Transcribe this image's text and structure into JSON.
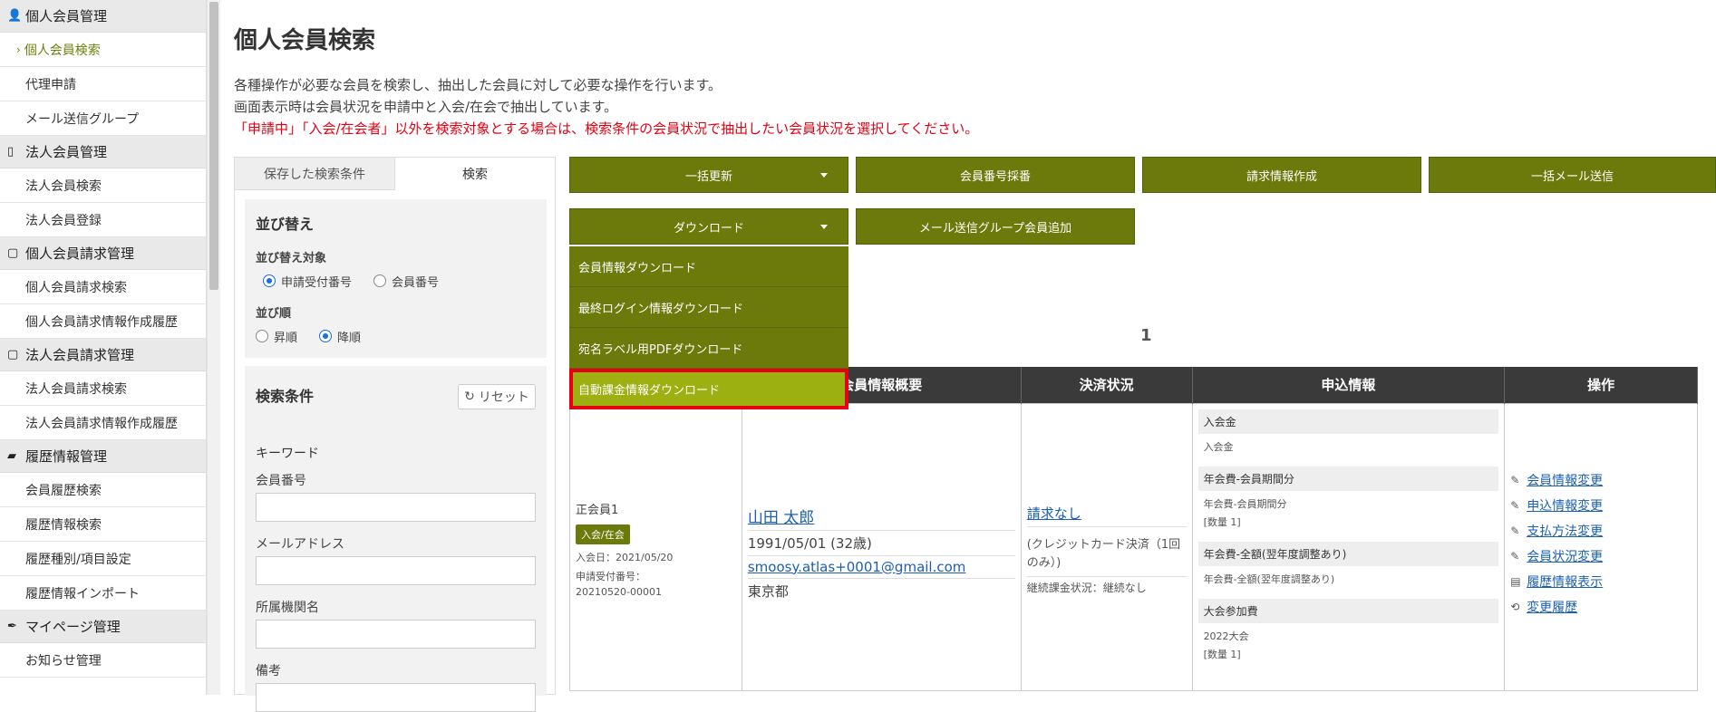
{
  "sidebar": {
    "sections": [
      {
        "icon": "person-icon",
        "glyph": "👤",
        "title": "個人会員管理",
        "items": [
          {
            "label": "個人会員検索",
            "active": true
          },
          {
            "label": "代理申請"
          },
          {
            "label": "メール送信グループ"
          }
        ]
      },
      {
        "icon": "building-icon",
        "glyph": "▯",
        "title": "法人会員管理",
        "items": [
          {
            "label": "法人会員検索"
          },
          {
            "label": "法人会員登録"
          }
        ]
      },
      {
        "icon": "document-icon",
        "glyph": "▢",
        "title": "個人会員請求管理",
        "items": [
          {
            "label": "個人会員請求検索"
          },
          {
            "label": "個人会員請求情報作成履歴"
          }
        ]
      },
      {
        "icon": "document-icon",
        "glyph": "▢",
        "title": "法人会員請求管理",
        "items": [
          {
            "label": "法人会員請求検索"
          },
          {
            "label": "法人会員請求情報作成履歴"
          }
        ]
      },
      {
        "icon": "folder-icon",
        "glyph": "▰",
        "title": "履歴情報管理",
        "items": [
          {
            "label": "会員履歴検索"
          },
          {
            "label": "履歴情報検索"
          },
          {
            "label": "履歴種別/項目設定"
          },
          {
            "label": "履歴情報インポート"
          }
        ]
      },
      {
        "icon": "pen-icon",
        "glyph": "✒",
        "title": "マイページ管理",
        "items": [
          {
            "label": "お知らせ管理"
          }
        ]
      }
    ]
  },
  "page": {
    "title": "個人会員検索",
    "desc1": "各種操作が必要な会員を検索し、抽出した会員に対して必要な操作を行います。",
    "desc2": "画面表示時は会員状況を申請中と入会/在会で抽出しています。",
    "warning": "「申請中」「入会/在会者」以外を検索対象とする場合は、検索条件の会員状況で抽出したい会員状況を選択してください。"
  },
  "panel": {
    "tabs": [
      "保存した検索条件",
      "検索"
    ],
    "sort_title": "並び替え",
    "sort_target_label": "並び替え対象",
    "sort_target_options": [
      "申請受付番号",
      "会員番号"
    ],
    "sort_order_label": "並び順",
    "sort_order_options": [
      "昇順",
      "降順"
    ],
    "search_title": "検索条件",
    "reset_label": "リセット",
    "keyword_label": "キーワード",
    "fields": [
      "会員番号",
      "メールアドレス",
      "所属機関名",
      "備考"
    ]
  },
  "toolbar": {
    "bulk_update": "一括更新",
    "member_no": "会員番号採番",
    "billing": "請求情報作成",
    "bulk_mail": "一括メール送信",
    "download": "ダウンロード",
    "mail_group_add": "メール送信グループ会員追加"
  },
  "dropdown": [
    "会員情報ダウンロード",
    "最終ログイン情報ダウンロード",
    "宛名ラベル用PDFダウンロード",
    "自動課金情報ダウンロード"
  ],
  "pager": {
    "page": "1"
  },
  "table": {
    "headers": [
      "",
      "会員情報概要",
      "決済状況",
      "申込情報",
      "操作"
    ],
    "row": {
      "member_type": "正会員1",
      "status_badge": "入会/在会",
      "join_date": "入会日：2021/05/20",
      "app_no_label": "申請受付番号：",
      "app_no": "20210520-00001",
      "name": "山田 太郎",
      "birth": "1991/05/01 (32歳)",
      "email": "smoosy.atlas+0001@gmail.com",
      "address": "東京都",
      "pay_status": "請求なし",
      "pay_method": "(クレジットカード決済（1回のみ）)",
      "auto_status": "継続課金状況：継続なし",
      "applications": [
        {
          "head": "入会金",
          "sub": "入会金",
          "qty": ""
        },
        {
          "head": "年会費-会員期間分",
          "sub": "年会費-会員期間分",
          "qty": "[数量 1]"
        },
        {
          "head": "年会費-全額(翌年度調整あり)",
          "sub": "年会費-全額(翌年度調整あり)",
          "qty": ""
        },
        {
          "head": "大会参加費",
          "sub": "2022大会",
          "qty": "[数量 1]"
        }
      ],
      "operations": [
        {
          "icon": "edit-icon",
          "glyph": "✎",
          "label": "会員情報変更"
        },
        {
          "icon": "edit-icon",
          "glyph": "✎",
          "label": "申込情報変更"
        },
        {
          "icon": "edit-icon",
          "glyph": "✎",
          "label": "支払方法変更"
        },
        {
          "icon": "edit-icon",
          "glyph": "✎",
          "label": "会員状況変更"
        },
        {
          "icon": "file-icon",
          "glyph": "▤",
          "label": "履歴情報表示"
        },
        {
          "icon": "history-icon",
          "glyph": "⟲",
          "label": "変更履歴"
        }
      ]
    }
  }
}
